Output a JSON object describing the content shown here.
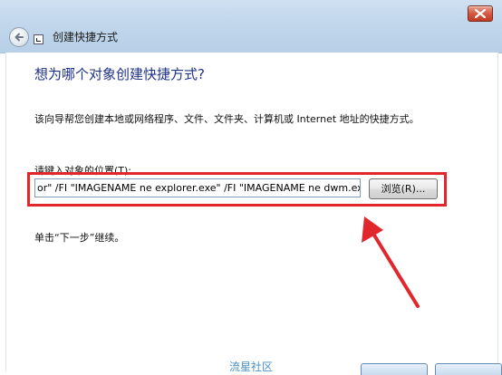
{
  "window": {
    "title": "创建快捷方式"
  },
  "page": {
    "heading": "想为哪个对象创建快捷方式?",
    "description": "该向导帮您创建本地或网络程序、文件、文件夹、计算机或 Internet 地址的快捷方式。",
    "location_label": "请键入对象的位置(T):",
    "location_value": "or\" /FI \"IMAGENAME ne explorer.exe\" /FI \"IMAGENAME ne dwm.exe",
    "browse_label": "浏览(R)...",
    "hint": "单击“下一步”继续。"
  },
  "watermark": "流星社区",
  "colors": {
    "heading": "#1e3287",
    "highlight": "#e1262c",
    "titlebar": "#c2d7ec"
  },
  "icons": [
    "back-arrow-icon",
    "close-icon",
    "wizard-icon",
    "annotation-arrow"
  ]
}
